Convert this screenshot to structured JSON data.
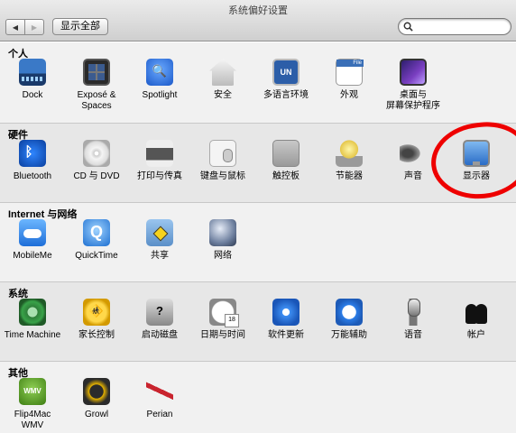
{
  "window": {
    "title": "系统偏好设置",
    "show_all_label": "显示全部",
    "back_glyph": "◀",
    "forward_glyph": "▶",
    "search_placeholder": "",
    "search_value": ""
  },
  "colors": {
    "annotation_circle": "#ee0000",
    "section_bg_light": "#f1f1f1",
    "section_bg_dark": "#e7e7e7"
  },
  "sections": [
    {
      "title": "个人",
      "items": [
        {
          "label": "Dock",
          "icon": "dock-icon"
        },
        {
          "label": "Exposé &\nSpaces",
          "icon": "expose-spaces-icon"
        },
        {
          "label": "Spotlight",
          "icon": "spotlight-icon"
        },
        {
          "label": "安全",
          "icon": "security-house-icon"
        },
        {
          "label": "多语言环境",
          "icon": "un-flag-icon"
        },
        {
          "label": "外观",
          "icon": "appearance-window-icon"
        },
        {
          "label": "桌面与\n屏幕保护程序",
          "icon": "desktop-screensaver-icon"
        }
      ]
    },
    {
      "title": "硬件",
      "items": [
        {
          "label": "Bluetooth",
          "icon": "bluetooth-icon"
        },
        {
          "label": "CD 与 DVD",
          "icon": "cd-disc-icon"
        },
        {
          "label": "打印与传真",
          "icon": "printer-icon"
        },
        {
          "label": "键盘与鼠标",
          "icon": "keyboard-mouse-icon"
        },
        {
          "label": "触控板",
          "icon": "trackpad-icon"
        },
        {
          "label": "节能器",
          "icon": "lightbulb-icon"
        },
        {
          "label": "声音",
          "icon": "speaker-icon"
        },
        {
          "label": "显示器",
          "icon": "display-monitor-icon"
        }
      ]
    },
    {
      "title": "Internet 与网络",
      "items": [
        {
          "label": "MobileMe",
          "icon": "mobileme-cloud-icon"
        },
        {
          "label": "QuickTime",
          "icon": "quicktime-icon"
        },
        {
          "label": "共享",
          "icon": "sharing-folder-icon"
        },
        {
          "label": "网络",
          "icon": "network-globe-icon"
        }
      ]
    },
    {
      "title": "系统",
      "items": [
        {
          "label": "Time Machine",
          "icon": "time-machine-icon"
        },
        {
          "label": "家长控制",
          "icon": "parental-controls-icon"
        },
        {
          "label": "启动磁盘",
          "icon": "startup-disk-icon"
        },
        {
          "label": "日期与时间",
          "icon": "date-time-clock-icon"
        },
        {
          "label": "软件更新",
          "icon": "software-update-icon"
        },
        {
          "label": "万能辅助",
          "icon": "universal-access-icon"
        },
        {
          "label": "语音",
          "icon": "microphone-icon"
        },
        {
          "label": "帐户",
          "icon": "accounts-people-icon"
        }
      ]
    },
    {
      "title": "其他",
      "items": [
        {
          "label": "Flip4Mac\nWMV",
          "icon": "flip4mac-wmv-icon"
        },
        {
          "label": "Growl",
          "icon": "growl-paw-icon"
        },
        {
          "label": "Perian",
          "icon": "perian-knife-icon"
        }
      ]
    }
  ]
}
